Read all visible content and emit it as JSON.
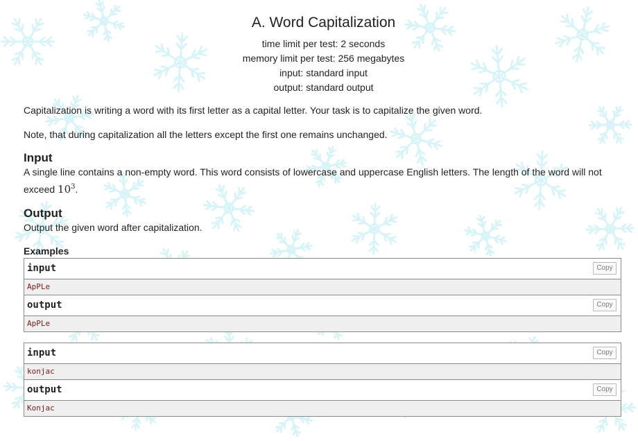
{
  "problem": {
    "title": "A. Word Capitalization",
    "time_limit": "time limit per test: 2 seconds",
    "memory_limit": "memory limit per test: 256 megabytes",
    "input_file": "input: standard input",
    "output_file": "output: standard output"
  },
  "statement": {
    "p1": "Capitalization is writing a word with its first letter as a capital letter. Your task is to capitalize the given word.",
    "p2": "Note, that during capitalization all the letters except the first one remains unchanged."
  },
  "input_section": {
    "title": "Input",
    "text_before": "A single line contains a non-empty word. This word consists of lowercase and uppercase English letters. The length of the word will not exceed ",
    "math_base": "10",
    "math_exp": "3",
    "text_after": "."
  },
  "output_section": {
    "title": "Output",
    "text": "Output the given word after capitalization."
  },
  "examples": {
    "title": "Examples",
    "copy_label": "Copy",
    "input_label": "input",
    "output_label": "output",
    "items": [
      {
        "input": "ApPLe",
        "output": "ApPLe"
      },
      {
        "input": "konjac",
        "output": "Konjac"
      }
    ]
  },
  "colors": {
    "snowflake": "#d8f4f8",
    "border": "#8a8a8a",
    "sample_bg": "#efefef",
    "sample_text": "#7a1b1b"
  }
}
